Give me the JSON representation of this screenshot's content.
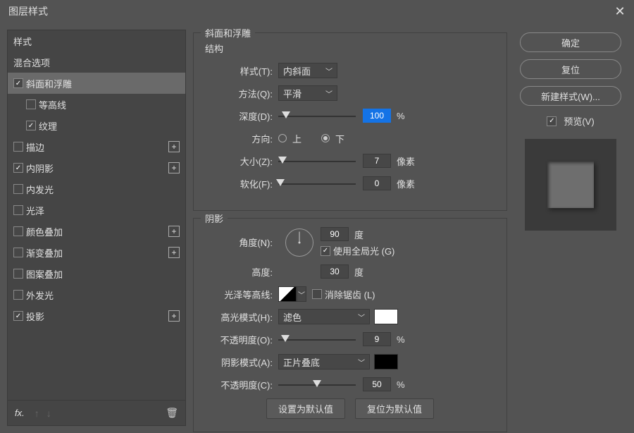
{
  "title": "图层样式",
  "styles_header": "样式",
  "blend_header": "混合选项",
  "effects": {
    "bevel": {
      "label": "斜面和浮雕",
      "checked": true
    },
    "contour": {
      "label": "等高线",
      "checked": false
    },
    "texture": {
      "label": "纹理",
      "checked": true
    },
    "stroke": {
      "label": "描边",
      "checked": false
    },
    "innerShadow": {
      "label": "内阴影",
      "checked": true
    },
    "innerGlow": {
      "label": "内发光",
      "checked": false
    },
    "satin": {
      "label": "光泽",
      "checked": false
    },
    "colorOverlay": {
      "label": "颜色叠加",
      "checked": false
    },
    "gradientOverlay": {
      "label": "渐变叠加",
      "checked": false
    },
    "patternOverlay": {
      "label": "图案叠加",
      "checked": false
    },
    "outerGlow": {
      "label": "外发光",
      "checked": false
    },
    "dropShadow": {
      "label": "投影",
      "checked": true
    }
  },
  "fx_label": "fx.",
  "panel": {
    "section1_title": "斜面和浮雕",
    "structure_title": "结构",
    "style_label": "样式(T):",
    "style_value": "内斜面",
    "technique_label": "方法(Q):",
    "technique_value": "平滑",
    "depth_label": "深度(D):",
    "depth_value": "100",
    "depth_unit": "%",
    "direction_label": "方向:",
    "direction_up": "上",
    "direction_down": "下",
    "size_label": "大小(Z):",
    "size_value": "7",
    "size_unit": "像素",
    "soften_label": "软化(F):",
    "soften_value": "0",
    "soften_unit": "像素",
    "shading_title": "阴影",
    "angle_label": "角度(N):",
    "angle_value": "90",
    "angle_unit": "度",
    "global_light": "使用全局光 (G)",
    "altitude_label": "高度:",
    "altitude_value": "30",
    "altitude_unit": "度",
    "gloss_label": "光泽等高线:",
    "antialias": "消除锯齿 (L)",
    "highlight_mode_label": "高光模式(H):",
    "highlight_mode_value": "滤色",
    "highlight_color": "#ffffff",
    "highlight_opacity_label": "不透明度(O):",
    "highlight_opacity_value": "9",
    "highlight_opacity_unit": "%",
    "shadow_mode_label": "阴影模式(A):",
    "shadow_mode_value": "正片叠底",
    "shadow_color": "#000000",
    "shadow_opacity_label": "不透明度(C):",
    "shadow_opacity_value": "50",
    "shadow_opacity_unit": "%",
    "make_default": "设置为默认值",
    "reset_default": "复位为默认值"
  },
  "buttons": {
    "ok": "确定",
    "cancel": "复位",
    "newStyle": "新建样式(W)...",
    "preview": "预览(V)"
  }
}
